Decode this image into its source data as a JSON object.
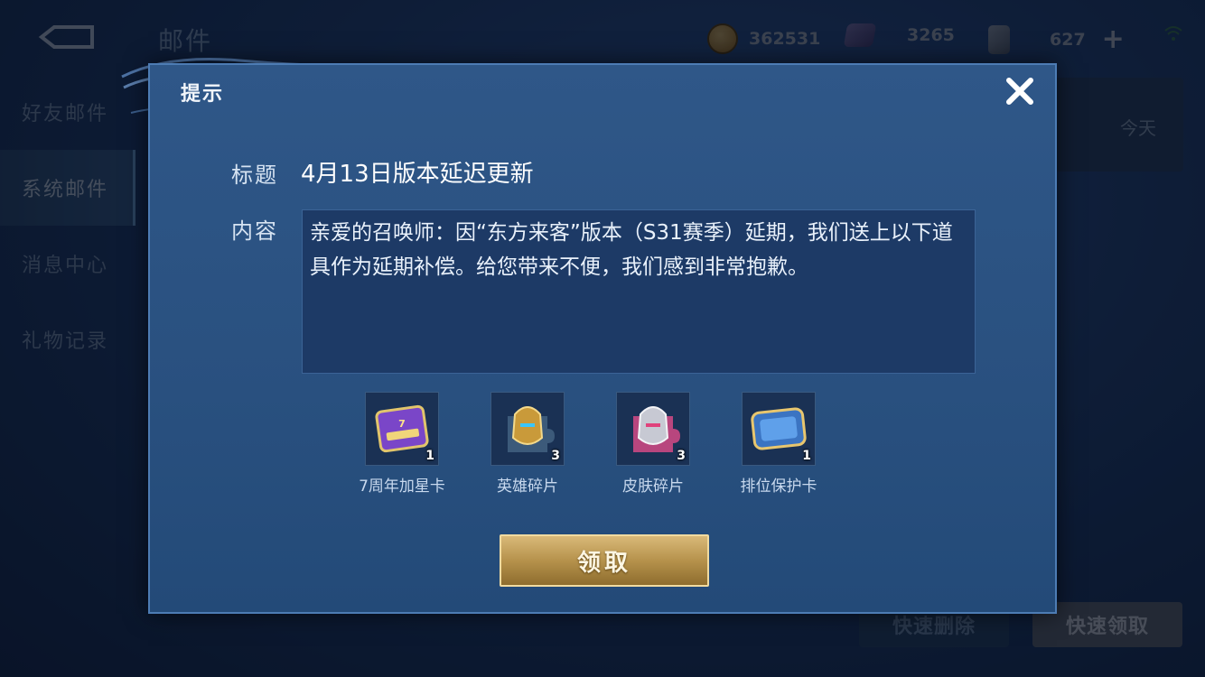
{
  "page": {
    "title": "邮件",
    "currencies": [
      {
        "icon": "gold-coin-icon",
        "value": "362531"
      },
      {
        "icon": "diamond-icon",
        "value": "3265"
      },
      {
        "icon": "ticket-icon",
        "value": "627"
      }
    ],
    "add_icon": "plus-icon",
    "sidebar": [
      "好友邮件",
      "系统邮件",
      "消息中心",
      "礼物记录"
    ],
    "active_sidebar": 1,
    "mail_date": "今天",
    "buttons": {
      "delete": "快速删除",
      "claim_all": "快速领取"
    }
  },
  "dialog": {
    "title": "提示",
    "subject_label": "标题",
    "subject": "4月13日版本延迟更新",
    "content_label": "内容",
    "content": "亲爱的召唤师：因“东方来客”版本（S31赛季）延期，我们送上以下道具作为延期补偿。给您带来不便，我们感到非常抱歉。",
    "items": [
      {
        "name": "7周年加星卡",
        "count": "1",
        "icon": "star-card-icon"
      },
      {
        "name": "英雄碎片",
        "count": "3",
        "icon": "hero-fragment-icon"
      },
      {
        "name": "皮肤碎片",
        "count": "3",
        "icon": "skin-fragment-icon"
      },
      {
        "name": "排位保护卡",
        "count": "1",
        "icon": "rank-protect-card-icon"
      }
    ],
    "claim_label": "领取"
  },
  "colors": {
    "accent_gold": "#c9a75e",
    "panel_blue": "#2f5788"
  }
}
